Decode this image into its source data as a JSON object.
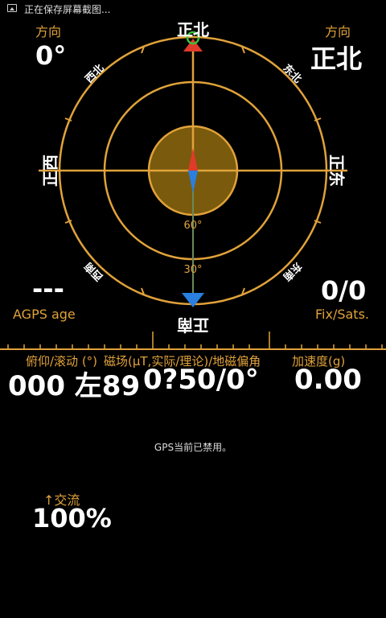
{
  "status_bar": {
    "notification_text": "正在保存屏幕截图..."
  },
  "heading_left": {
    "label": "方向",
    "value": "0°"
  },
  "heading_right": {
    "label": "方向",
    "value": "正北"
  },
  "compass": {
    "north": "正北",
    "south": "正南",
    "east": "正东",
    "west": "正西",
    "northeast": "东北",
    "northwest": "西北",
    "southeast": "东南",
    "southwest": "西南",
    "elev_60": "60°",
    "elev_30": "30°"
  },
  "agps": {
    "value": "---",
    "label": "AGPS age"
  },
  "fix": {
    "value": "0/0",
    "label": "Fix/Sats."
  },
  "sensor_labels": {
    "pitch_roll": "俯仰/滚动 (°)",
    "magnetic": "磁场(μT,实际/理论)/地磁偏角",
    "accel": "加速度(g)"
  },
  "sensor_values": {
    "pitch_roll": "000 左89",
    "magnetic": "0?50/0°",
    "accel": "0.00"
  },
  "gps_status": "GPS当前已禁用。",
  "battery": {
    "arrow": "↑",
    "label": "交流",
    "value": "100%"
  },
  "colors": {
    "accent": "#e0a23a",
    "background": "#000000",
    "north_marker": "#e03a2a",
    "south_marker": "#2a7fe0"
  }
}
